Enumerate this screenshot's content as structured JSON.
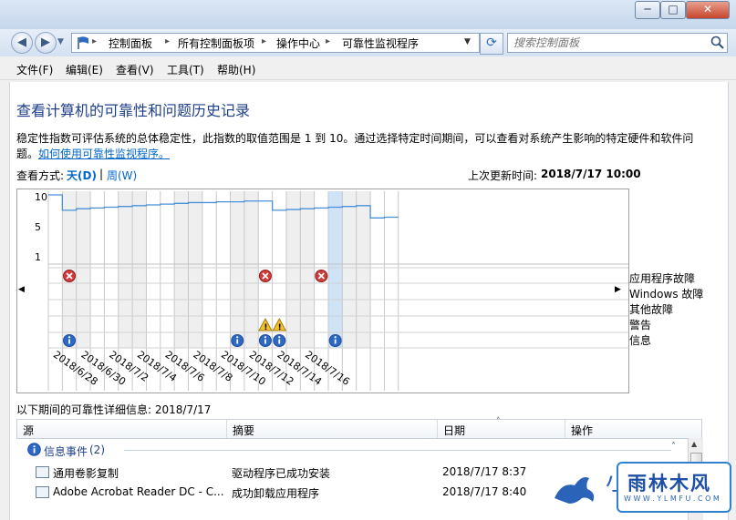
{
  "title_controls": {
    "minimize": "─",
    "maximize": "□",
    "close": "✕"
  },
  "nav": {
    "back_icon": "arrow-left-icon",
    "forward_icon": "arrow-right-icon",
    "breadcrumb": [
      "控制面板",
      "所有控制面板项",
      "操作中心",
      "可靠性监视程序"
    ],
    "breadcrumb_sep": "▸",
    "search_placeholder": "搜索控制面板"
  },
  "menu": [
    "文件(F)",
    "编辑(E)",
    "查看(V)",
    "工具(T)",
    "帮助(H)"
  ],
  "page": {
    "heading": "查看计算机的可靠性和问题历史记录",
    "description": "稳定性指数可评估系统的总体稳定性，此指数的取值范围是 1 到 10。通过选择特定时间期间，可以查看对系统产生影响的特定硬件和软件问",
    "description_cont": "题。",
    "help_link": "如何使用可靠性监视程序。",
    "view_by_label": "查看方式:",
    "view_day": "天(D)",
    "view_sep": "|",
    "view_week": "周(W)",
    "last_updated_label": "上次更新时间:",
    "last_updated_value": "2018/7/17 10:00",
    "details_label": "以下期间的可靠性详细信息: 2018/7/17"
  },
  "chart_data": {
    "type": "line",
    "y_ticks": [
      "10",
      "5",
      "1"
    ],
    "ylim": [
      1,
      10
    ],
    "x_labels": [
      "2018/6/28",
      "2018/6/30",
      "2018/7/2",
      "2018/7/4",
      "2018/7/6",
      "2018/7/8",
      "2018/7/10",
      "2018/7/12",
      "2018/7/14",
      "2018/7/16"
    ],
    "stability_index": [
      10,
      8.0,
      8.2,
      8.3,
      8.4,
      8.5,
      8.6,
      8.7,
      8.8,
      8.9,
      9.0,
      9.0,
      9.1,
      9.1,
      9.2,
      9.2,
      8.0,
      8.1,
      8.2,
      8.3,
      8.4,
      8.5,
      8.6,
      7.0,
      7.1
    ],
    "legend": [
      "应用程序故障",
      "Windows 故障",
      "其他故障",
      "警告",
      "信息"
    ],
    "events": {
      "app_failure": [
        1,
        15,
        19
      ],
      "warning": [
        15,
        16
      ],
      "information": [
        1,
        13,
        15,
        16,
        20
      ]
    },
    "selected_column": 20
  },
  "table": {
    "columns": [
      "源",
      "摘要",
      "日期",
      "操作"
    ],
    "group": {
      "label": "信息事件",
      "count": "(2)"
    },
    "rows": [
      {
        "source": "通用卷影复制",
        "summary": "驱动程序已成功安装",
        "date": "2018/7/17 8:37"
      },
      {
        "source": "Adobe Acrobat Reader DC - C...",
        "summary": "成功卸载应用程序",
        "date": "2018/7/17 8:40"
      }
    ]
  },
  "watermark": {
    "brand": "雨林木风",
    "url": "W W W . Y L M F U . C O M",
    "mark": "小"
  },
  "colors": {
    "accent": "#0066cc",
    "line": "#4a90d9",
    "selected": "#cfe3f7"
  }
}
